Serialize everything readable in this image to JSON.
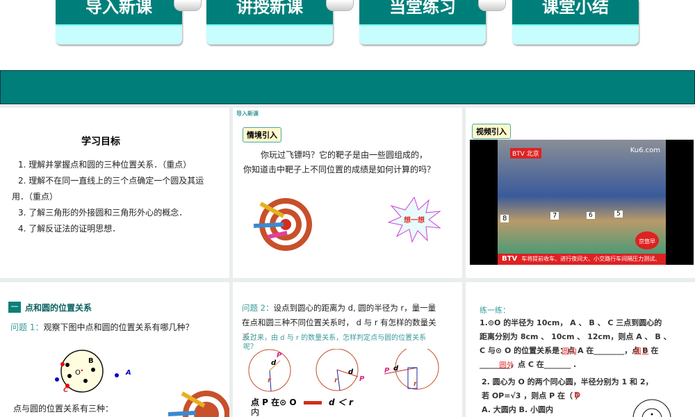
{
  "nav": {
    "tabs": [
      "导入新课",
      "讲授新课",
      "当堂练习",
      "课堂小结"
    ]
  },
  "objectives": {
    "title": "学习目标",
    "items": [
      "1. 理解并掌握点和圆的三种位置关系．（重点）",
      "2. 理解不在同一直线上的三个点确定一个圆及其运",
      "用．（重点）",
      "3. 了解三角形的外接圆和三角形外心的概念．",
      "4. 了解反证法的证明思想．"
    ]
  },
  "intro": {
    "section": "导入新课",
    "tag": "情境引入",
    "line1": "你玩过飞镖吗？它的靶子是由一些圆组成的，",
    "line2": "你知道击中靶子上不同位置的成绩是如何计算的吗？",
    "think": "想一想"
  },
  "video": {
    "tag": "视频引入",
    "channel": "BTV 北京",
    "logo": "Ku6.com",
    "ticker": "车将提前收车、进行夜间大、小交路行车间隔压力测试、",
    "ticker_brand": "BTV",
    "corner": "京悠早",
    "lanes": [
      "8",
      "7",
      "6",
      "5"
    ]
  },
  "position": {
    "badge": "一",
    "title": "点和圆的位置关系",
    "q1_label": "问题 1：",
    "q1": "观察下图中点和圆的位置关系有哪几种？",
    "labels": {
      "B": "B",
      "O": "O",
      "A": "A",
      "C": "C"
    },
    "summary": "点与圆的位置关系有三种："
  },
  "q2": {
    "label": "问题 2：",
    "text1": "设点到圆心的距离为 d, 圆的半径为 r，量一量",
    "text2": "在点和圆三种不同位置关系时， d 与 r 有怎样的数量关",
    "text3": "系？",
    "overlay1": "反过来，由 d 与 r 的数量关系，怎样判定点与圆的位置关系",
    "overlay2": "呢？",
    "fig": {
      "P": "P",
      "d": "d",
      "r": "r"
    },
    "rule_a": "点 P 在⊙ O",
    "rule_b": "d ＜ r",
    "rule_c": "内"
  },
  "practice": {
    "title": "练一练：",
    "p1a": "1.⊙O 的半径为 10cm， A 、 B 、 C 三点到圆心的",
    "p1b": "距离分别为 8cm 、 10cm 、 12cm，则点 A 、 B 、",
    "p1c": "C 与⊙ O 的位置关系是：点 A 在________，点 B 在",
    "p1d": "________，点 C 在_______ .",
    "ans": [
      "圆内",
      "圆上",
      "圆外"
    ],
    "p2a": "2. 圆心为 O 的两个同心圆，半径分别为 1 和 2，",
    "p2b": "若 OP=√3 ，则点 P 在（    ）",
    "ans2": "D",
    "opt": "A. 大圆内        B. 小圆内"
  }
}
